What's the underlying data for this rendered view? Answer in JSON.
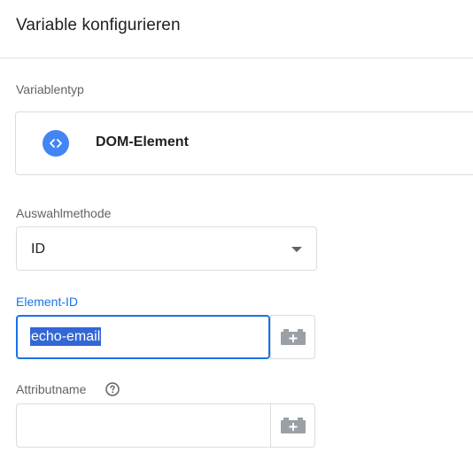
{
  "panel": {
    "title": "Variable konfigurieren"
  },
  "variable_type": {
    "label": "Variablentyp",
    "icon": "code-brackets-icon",
    "name": "DOM-Element",
    "icon_color": "#4285f4"
  },
  "selection_method": {
    "label": "Auswahlmethode",
    "selected": "ID"
  },
  "element_id": {
    "label": "Element-ID",
    "value": "echo-email",
    "focused": true,
    "accent_color": "#1a73e8"
  },
  "attribute_name": {
    "label": "Attributname",
    "value": ""
  }
}
